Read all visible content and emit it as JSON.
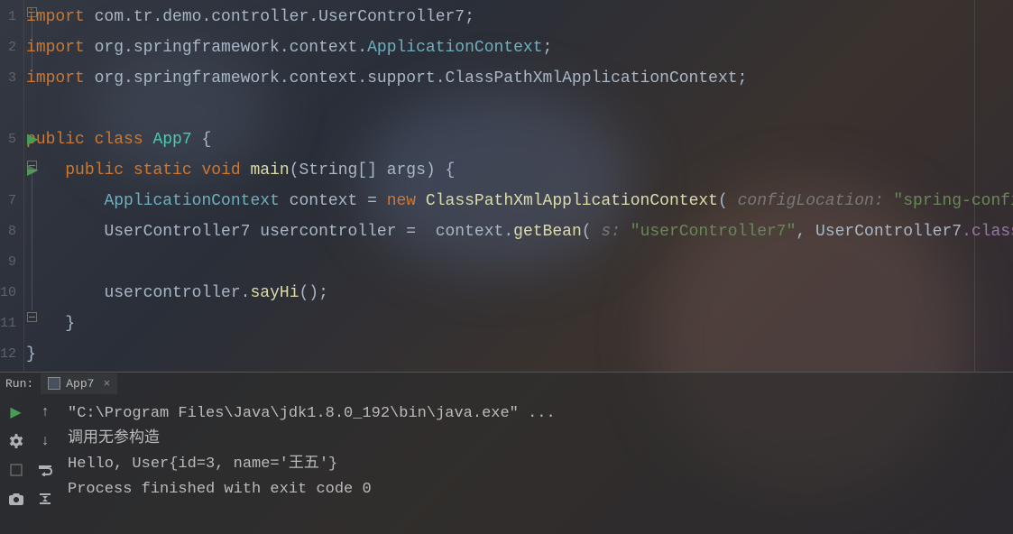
{
  "editor": {
    "lines": {
      "l1": {
        "num": "1",
        "import": "import",
        "pkg": " com.tr.demo.controller.",
        "cls": "UserController7",
        "end": ";"
      },
      "l2": {
        "num": "2",
        "import": "import",
        "pkg": " org.springframework.context.",
        "cls": "ApplicationContext",
        "end": ";"
      },
      "l3": {
        "num": "3",
        "import": "import",
        "pkg": " org.springframework.context.support.",
        "cls": "ClassPathXmlApplicationContext",
        "end": ";"
      },
      "l4": {
        "num": ""
      },
      "l5": {
        "num": "5",
        "kw1": "public class ",
        "cls": "App7",
        "brace": " {"
      },
      "l6": {
        "num": "",
        "kw1": "public static void ",
        "fn": "main",
        "params": "(String[] args) {"
      },
      "l7": {
        "num": "7",
        "type": "ApplicationContext",
        "var": " context ",
        "op": "= ",
        "new": "new ",
        "ctor": "ClassPathXmlApplicationContext",
        "open": "( ",
        "hint": "configLocation: ",
        "str": "\"spring-config.xml\"",
        "close": ");"
      },
      "l8": {
        "num": "8",
        "type": "UserController7",
        "var": " usercontroller ",
        "op": "=  ",
        "ctx": "context",
        "dot": ".",
        "method": "getBean",
        "open": "( ",
        "hint": "s: ",
        "str": "\"userController7\"",
        "comma": ", ",
        "cls2": "UserController7",
        "field": ".class",
        "close": ");"
      },
      "l9": {
        "num": "9"
      },
      "l10": {
        "num": "10",
        "var": "usercontroller",
        "dot": ".",
        "method": "sayHi",
        "close": "();"
      },
      "l11": {
        "num": "11",
        "brace": "}"
      },
      "l12": {
        "num": "12",
        "brace": "}"
      }
    }
  },
  "runPanel": {
    "label": "Run:",
    "tabName": "App7",
    "console": {
      "line1": "\"C:\\Program Files\\Java\\jdk1.8.0_192\\bin\\java.exe\" ...",
      "line2": "调用无参构造",
      "line3": "Hello, User{id=3, name='王五'}",
      "line4": "",
      "line5": "Process finished with exit code 0"
    }
  }
}
